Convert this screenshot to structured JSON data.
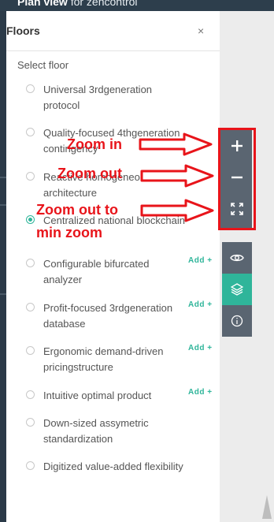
{
  "header": {
    "title_bold": "Plan view",
    "title_rest": " for zencontrol"
  },
  "panel": {
    "title": "Floors",
    "close": "×",
    "select_label": "Select floor",
    "floors": [
      {
        "name": "Universal 3rdgeneration protocol",
        "selected": false,
        "add": ""
      },
      {
        "name": "Quality-focused 4thgeneration contingency",
        "selected": false,
        "add": ""
      },
      {
        "name": "Reactive homogeneous architecture",
        "selected": false,
        "add": ""
      },
      {
        "name": "Centralized national blockchain",
        "selected": true,
        "add": ""
      },
      {
        "name": "Configurable bifurcated analyzer",
        "selected": false,
        "add": "Add +"
      },
      {
        "name": "Profit-focused 3rdgeneration database",
        "selected": false,
        "add": "Add +"
      },
      {
        "name": "Ergonomic demand-driven pricingstructure",
        "selected": false,
        "add": "Add +"
      },
      {
        "name": "Intuitive optimal product",
        "selected": false,
        "add": "Add +"
      },
      {
        "name": "Down-sized assymetric standardization",
        "selected": false,
        "add": ""
      },
      {
        "name": "Digitized value-added flexibility",
        "selected": false,
        "add": ""
      }
    ]
  },
  "controls": {
    "zoom_in": {
      "icon": "plus-icon"
    },
    "zoom_out": {
      "icon": "minus-icon"
    },
    "zoom_min": {
      "icon": "expand-icon"
    },
    "visibility": {
      "icon": "eye-icon"
    },
    "layers": {
      "icon": "layers-icon"
    },
    "info": {
      "icon": "info-icon"
    }
  },
  "annotations": {
    "zoom_in": "Zoom in",
    "zoom_out": "Zoom out",
    "zoom_min_line1": "Zoom out to",
    "zoom_min_line2": "min zoom",
    "color": "#e8141a"
  },
  "colors": {
    "accent": "#2fb59a",
    "control": "#5a6571",
    "header": "#2d3e4c"
  }
}
